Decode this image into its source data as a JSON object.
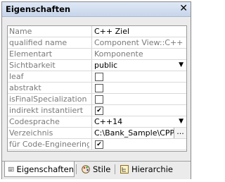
{
  "panel": {
    "title": "Eigenschaften",
    "close_icon": "close-icon"
  },
  "properties": [
    {
      "name": "Name",
      "type": "text",
      "value": "C++ Ziel",
      "muted": false
    },
    {
      "name": "qualified name",
      "type": "text",
      "value": "Component View::C++ ...",
      "muted": true
    },
    {
      "name": "Elementart",
      "type": "text",
      "value": "Komponente",
      "muted": true
    },
    {
      "name": "Sichtbarkeit",
      "type": "dropdown",
      "value": "public",
      "muted": false
    },
    {
      "name": "leaf",
      "type": "checkbox",
      "checked": false
    },
    {
      "name": "abstrakt",
      "type": "checkbox",
      "checked": false
    },
    {
      "name": "isFinalSpecialization",
      "type": "checkbox",
      "checked": false
    },
    {
      "name": "indirekt instantiiert",
      "type": "checkbox",
      "checked": true
    },
    {
      "name": "Codesprache",
      "type": "dropdown",
      "value": "C++14",
      "muted": false
    },
    {
      "name": "Verzeichnis",
      "type": "browse",
      "value": "C:\\Bank_Sample\\CPP",
      "button": "..."
    },
    {
      "name": "für Code-Engineering ...",
      "type": "checkbox",
      "checked": true
    }
  ],
  "tabs": [
    {
      "label": "Eigenschaften",
      "icon": "properties-icon",
      "active": true
    },
    {
      "label": "Stile",
      "icon": "palette-icon",
      "active": false
    },
    {
      "label": "Hierarchie",
      "icon": "hierarchy-icon",
      "active": false
    }
  ],
  "check_mark": "✔",
  "dropdown_arrow": "▼",
  "close_glyph": "✕"
}
